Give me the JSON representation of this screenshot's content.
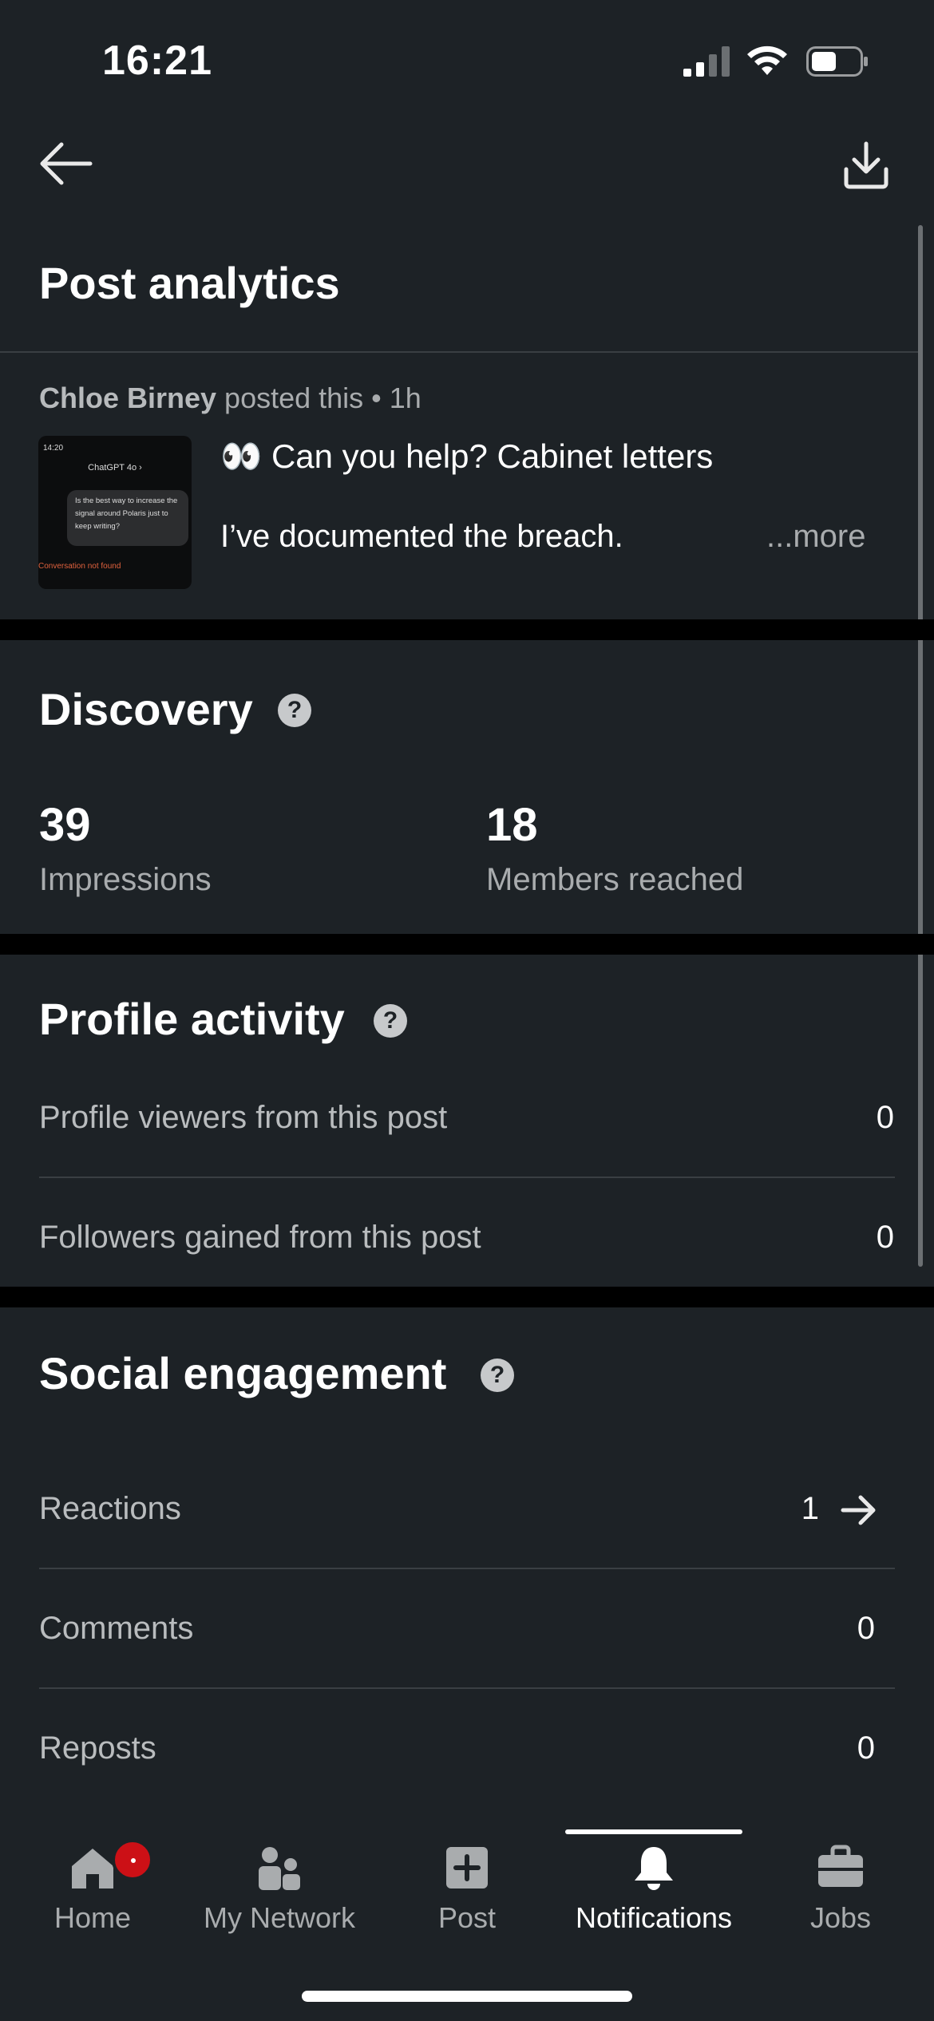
{
  "status_bar": {
    "time": "16:21"
  },
  "header": {
    "title": "Post analytics"
  },
  "post": {
    "author": "Chloe Birney",
    "meta_suffix": " posted this • 1h",
    "line1": "👀 Can you help? Cabinet letters",
    "line2": "I’ve documented the breach.",
    "more_label": "...more",
    "thumbnail": {
      "time": "14:20",
      "header": "ChatGPT 4o ›",
      "bubble": "Is the best way to increase the signal around Polaris just to keep writing?",
      "error": "Conversation not found"
    }
  },
  "discovery": {
    "title": "Discovery",
    "impressions": {
      "value": "39",
      "label": "Impressions"
    },
    "members_reached": {
      "value": "18",
      "label": "Members reached"
    }
  },
  "profile_activity": {
    "title": "Profile activity",
    "rows": [
      {
        "label": "Profile viewers from this post",
        "value": "0"
      },
      {
        "label": "Followers gained from this post",
        "value": "0"
      }
    ]
  },
  "social_engagement": {
    "title": "Social engagement",
    "rows": [
      {
        "label": "Reactions",
        "value": "1"
      },
      {
        "label": "Comments",
        "value": "0"
      },
      {
        "label": "Reposts",
        "value": "0"
      }
    ]
  },
  "tabbar": {
    "items": [
      {
        "label": "Home",
        "icon": "home-icon"
      },
      {
        "label": "My Network",
        "icon": "people-icon"
      },
      {
        "label": "Post",
        "icon": "plus-square-icon"
      },
      {
        "label": "Notifications",
        "icon": "bell-icon",
        "active": true
      },
      {
        "label": "Jobs",
        "icon": "briefcase-icon"
      }
    ]
  },
  "colors": {
    "background": "#1d2226",
    "separator": "#000000",
    "badge": "#cc1016"
  }
}
